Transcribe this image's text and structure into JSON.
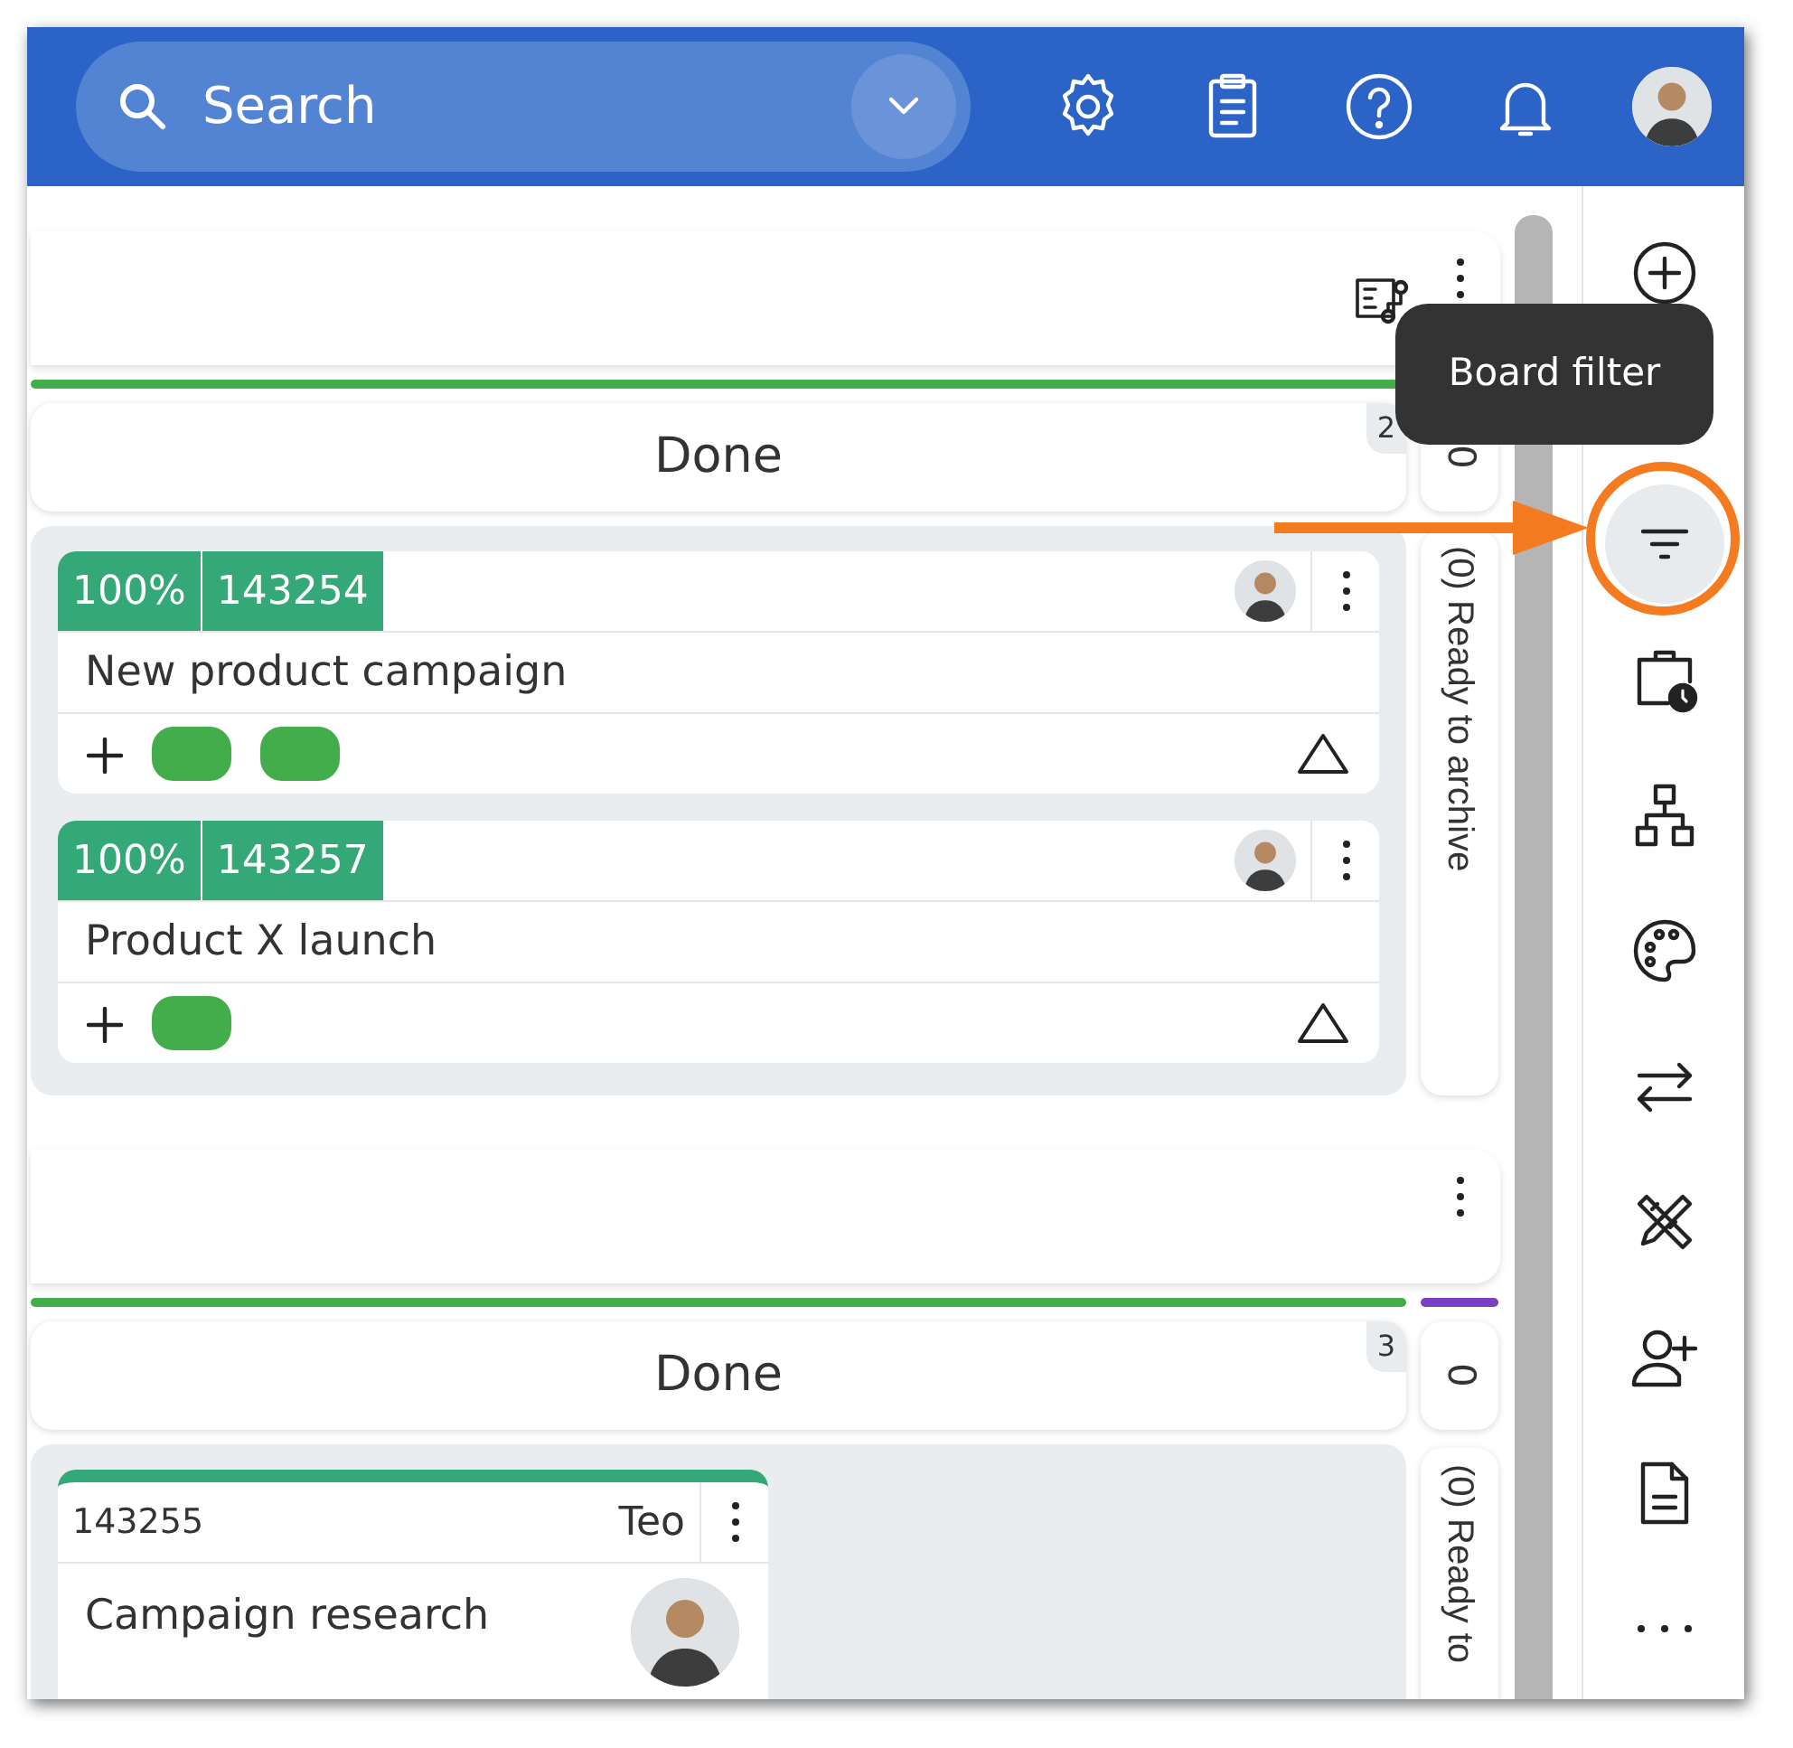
{
  "header": {
    "search": {
      "placeholder": "Search"
    }
  },
  "sections": [
    {
      "has_workflow": true,
      "line": {
        "color": "#43ad4b"
      },
      "column": {
        "title": "Done",
        "count": "2"
      },
      "side": {
        "count": "0",
        "label": "(0) Ready to archive"
      },
      "cards": [
        {
          "kind": "progress",
          "progress": "100%",
          "id": "143254",
          "title": "New product campaign",
          "tags": [
            {
              "color": "#43ad4b"
            },
            {
              "color": "#43ad4b"
            }
          ]
        },
        {
          "kind": "progress",
          "progress": "100%",
          "id": "143257",
          "title": "Product X launch",
          "tags": [
            {
              "color": "#43ad4b"
            }
          ]
        }
      ]
    },
    {
      "has_workflow": false,
      "line": {
        "color": "#43ad4b"
      },
      "side_line": {
        "color": "#7b3fc4"
      },
      "column": {
        "title": "Done",
        "count": "3"
      },
      "side": {
        "count": "0",
        "label": "(0) Ready to"
      },
      "cards": [
        {
          "kind": "plain",
          "id": "143255",
          "owner": "Teo",
          "title": "Campaign research",
          "top_bar": {
            "color": "#35a877"
          }
        }
      ]
    }
  ],
  "tools": [
    {
      "kind": "add",
      "selected": false
    },
    {
      "kind": "filter",
      "selected": true
    },
    {
      "kind": "schedule",
      "selected": false
    },
    {
      "kind": "hierarchy",
      "selected": false
    },
    {
      "kind": "palette",
      "selected": false
    },
    {
      "kind": "swap",
      "selected": false
    },
    {
      "kind": "tools",
      "selected": false
    },
    {
      "kind": "add-user",
      "selected": false
    },
    {
      "kind": "document",
      "selected": false
    },
    {
      "kind": "more",
      "selected": false
    }
  ],
  "tooltip": {
    "text": "Board filter"
  }
}
